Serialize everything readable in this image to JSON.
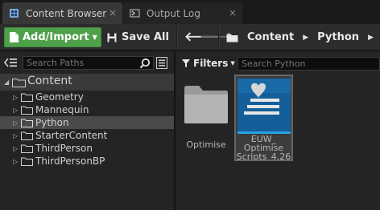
{
  "tabs": [
    {
      "label": "Content Browser",
      "icon": "content-browser-icon",
      "active": true
    },
    {
      "label": "Output Log",
      "icon": "output-log-icon",
      "active": false
    }
  ],
  "tab_close_glyph": "×",
  "toolbar": {
    "add_import_label": "Add/Import",
    "save_all_label": "Save All",
    "back_glyph": "🡐",
    "forward_glyph": "🡒",
    "breadcrumbs": [
      "Content",
      "Python"
    ],
    "accent_color": "#4fa04a"
  },
  "sources": {
    "search_placeholder": "Search Paths",
    "tree": [
      {
        "label": "Content",
        "depth": 0,
        "expanded": true
      },
      {
        "label": "Geometry",
        "depth": 1
      },
      {
        "label": "Mannequin",
        "depth": 1
      },
      {
        "label": "Python",
        "depth": 1,
        "selected": true
      },
      {
        "label": "StarterContent",
        "depth": 1
      },
      {
        "label": "ThirdPerson",
        "depth": 1
      },
      {
        "label": "ThirdPersonBP",
        "depth": 1
      }
    ]
  },
  "assets": {
    "filters_label": "Filters",
    "search_placeholder": "Search Python",
    "items": [
      {
        "type": "folder",
        "label": "Optimise"
      },
      {
        "type": "asset",
        "label": "EUW_ Optimise Scripts_4.26",
        "thumb_color": "#145f9a"
      }
    ]
  }
}
